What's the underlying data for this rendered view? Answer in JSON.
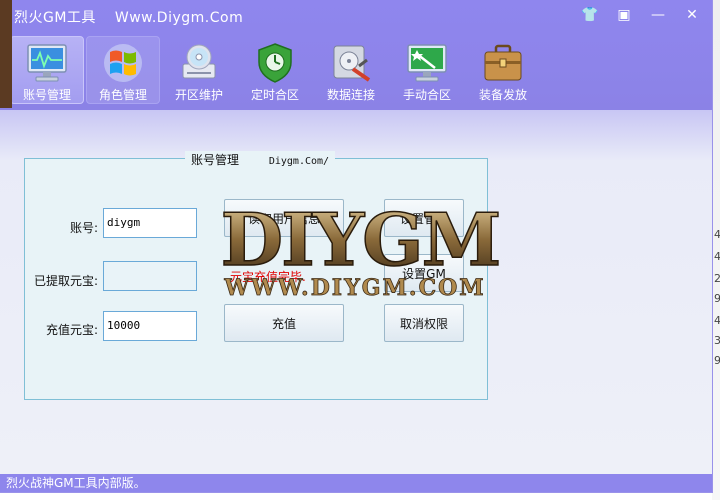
{
  "window": {
    "title": "烈火GM工具",
    "url": "Www.Diygm.Com",
    "buttons": [
      "👕",
      "▣",
      "—",
      "✕"
    ]
  },
  "toolbar": [
    {
      "label": "账号管理",
      "icon": "monitor-chart-icon",
      "active": true
    },
    {
      "label": "角色管理",
      "icon": "windows-logo-icon",
      "hover": true
    },
    {
      "label": "开区维护",
      "icon": "disc-drive-icon"
    },
    {
      "label": "定时合区",
      "icon": "shield-clock-icon"
    },
    {
      "label": "数据连接",
      "icon": "hard-disk-tools-icon"
    },
    {
      "label": "手动合区",
      "icon": "monitor-wand-icon"
    },
    {
      "label": "装备发放",
      "icon": "toolbox-icon"
    }
  ],
  "group": {
    "legend": "账号管理",
    "legend_sub": "Diygm.Com/"
  },
  "form": {
    "account_label": "账号:",
    "account_value": "diygm",
    "extracted_label": "已提取元宝:",
    "extracted_value": "",
    "recharge_label": "充值元宝:",
    "recharge_value": "10000"
  },
  "buttons": {
    "read_user_info": "读取用户信息",
    "set_admin": "设置管理",
    "set_gm": "设置GM",
    "recharge": "充值",
    "cancel_permission": "取消权限"
  },
  "status_message": "元宝充值完毕.",
  "statusbar": "烈火战神GM工具内部版。",
  "watermark": {
    "big": "DIYGM",
    "small": "WWW.DIYGM.COM"
  },
  "side_digits": [
    "4",
    "4",
    "2",
    "9",
    "4",
    "3",
    "9"
  ],
  "colors": {
    "title_bar": "#8d84ea",
    "group_border": "#7fbfd6",
    "status_red": "#e00000"
  }
}
